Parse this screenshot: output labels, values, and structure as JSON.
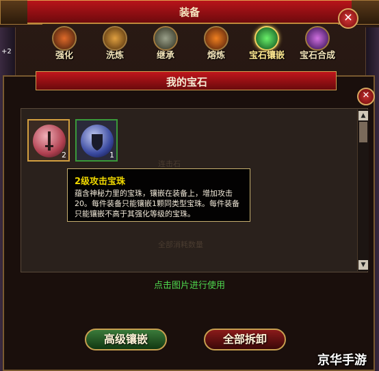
{
  "window": {
    "title": "装备",
    "close_symbol": "✕"
  },
  "tabs": [
    {
      "label": "强化",
      "icon": "anvil-hammer-icon"
    },
    {
      "label": "洗炼",
      "icon": "cauldron-icon"
    },
    {
      "label": "继承",
      "icon": "rune-stone-icon"
    },
    {
      "label": "熔炼",
      "icon": "furnace-icon"
    },
    {
      "label": "宝石镶嵌",
      "icon": "gem-socket-icon",
      "active": true
    },
    {
      "label": "宝石合成",
      "icon": "crystal-cluster-icon"
    }
  ],
  "gem_panel": {
    "title": "我的宝石",
    "close_symbol": "✕",
    "faint_texts": [
      "连击石",
      "全部消耗数量"
    ],
    "gems": [
      {
        "name": "attack-gem",
        "icon": "sword-icon",
        "count": "2",
        "color": "#d4a040",
        "selected": true
      },
      {
        "name": "defense-gem",
        "icon": "shield-icon",
        "count": "1",
        "color": "#3a9a3a"
      }
    ]
  },
  "tooltip": {
    "title": "2级攻击宝珠",
    "description": "蕴含神秘力里的宝珠，镶嵌在装备上，增加攻击20。每件装备只能镶嵌1颗同类型宝珠。每件装备只能镶嵌不高于其强化等级的宝珠。"
  },
  "hint": "点击图片进行使用",
  "buttons": {
    "advanced_inlay": "高级镶嵌",
    "remove_all": "全部拆卸"
  },
  "side": {
    "left_badge": "+2"
  },
  "watermark": "京华手游",
  "colors": {
    "title_red": "#b8141a",
    "border_gold": "#c8a050",
    "hint_green": "#4ed84e",
    "tooltip_yellow": "#f0d800"
  }
}
